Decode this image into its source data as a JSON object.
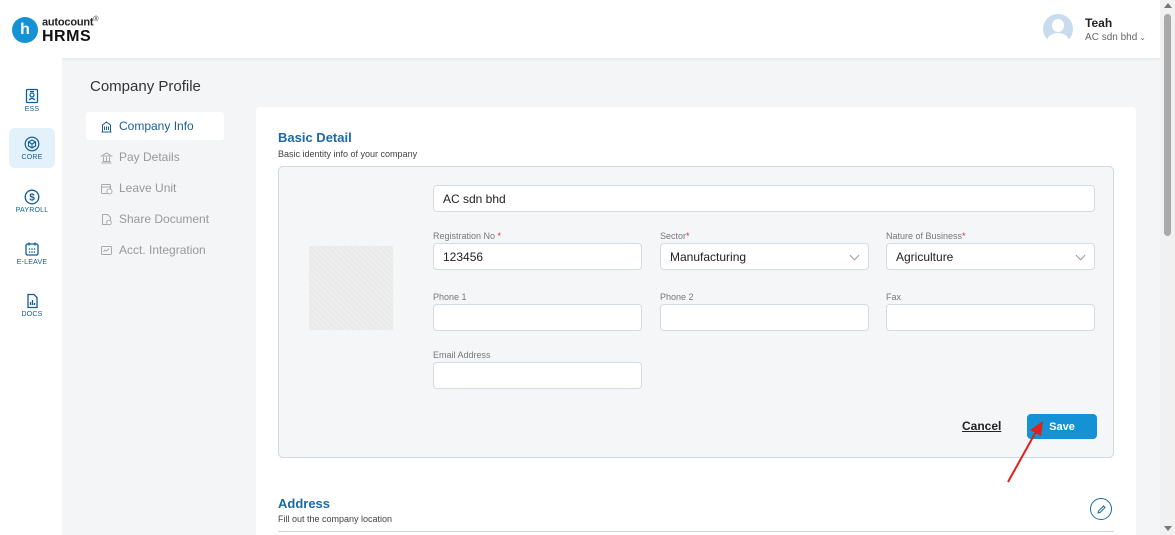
{
  "app": {
    "logo_letter": "h",
    "logo_top": "autocount",
    "logo_reg": "®",
    "logo_bottom": "HRMS"
  },
  "user": {
    "name": "Teah",
    "company": "AC sdn bhd",
    "chevron": "⌄"
  },
  "rail": [
    {
      "label": "ESS",
      "icon": "id-badge-icon",
      "active": false
    },
    {
      "label": "CORE",
      "icon": "cube-icon",
      "active": true
    },
    {
      "label": "PAYROLL",
      "icon": "dollar-coin-icon",
      "active": false
    },
    {
      "label": "E-LEAVE",
      "icon": "calendar-icon",
      "active": false
    },
    {
      "label": "DOCS",
      "icon": "document-chart-icon",
      "active": false
    }
  ],
  "page": {
    "title": "Company Profile"
  },
  "subnav": [
    {
      "label": "Company Info",
      "icon": "building-icon",
      "active": true
    },
    {
      "label": "Pay Details",
      "icon": "bank-icon",
      "active": false
    },
    {
      "label": "Leave Unit",
      "icon": "calendar-clock-icon",
      "active": false
    },
    {
      "label": "Share Document",
      "icon": "document-share-icon",
      "active": false
    },
    {
      "label": "Acct. Integration",
      "icon": "integration-icon",
      "active": false
    }
  ],
  "basic_detail": {
    "title": "Basic Detail",
    "subtitle": "Basic identity info of your company",
    "company_name": "AC sdn bhd",
    "registration_no": {
      "label": "Registration No",
      "required": "*",
      "value": "123456"
    },
    "sector": {
      "label": "Sector",
      "required": "*",
      "value": "Manufacturing"
    },
    "nature_of_business": {
      "label": "Nature of Business",
      "required": "*",
      "value": "Agriculture"
    },
    "phone1": {
      "label": "Phone 1",
      "value": ""
    },
    "phone2": {
      "label": "Phone 2",
      "value": ""
    },
    "fax": {
      "label": "Fax",
      "value": ""
    },
    "email": {
      "label": "Email Address",
      "value": ""
    },
    "cancel_label": "Cancel",
    "save_label": "Save"
  },
  "address": {
    "title": "Address",
    "subtitle": "Fill out the company location"
  },
  "colors": {
    "brand": "#1592d6",
    "heading": "#1b6aa5",
    "annotation_arrow": "#e0201b"
  }
}
